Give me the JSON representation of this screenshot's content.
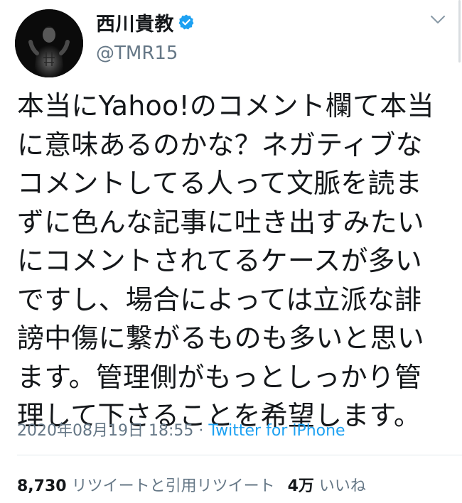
{
  "user": {
    "display_name": "西川貴教",
    "handle": "@TMR15",
    "verified": true
  },
  "tweet": {
    "lines": [
      "本当にYahoo!のコメント欄て本当",
      "に意味あるのかな？ネガティブな",
      "コメントしてる人って文脈を読ま",
      "ずに色んな記事に吐き出すみたい",
      "にコメントされてるケースが多い",
      "ですし、場合によっては立派な誹",
      "謗中傷に繋がるものも多いと思い",
      "ます。管理側がもっとしっかり管",
      "理して下さることを希望します。"
    ],
    "timestamp": "2020年08月19日 18:55",
    "separator": " · ",
    "source": "Twitter for iPhone"
  },
  "stats": {
    "retweets_count": "8,730",
    "retweets_label": "リツイートと引用リツイート",
    "likes_count": "4万",
    "likes_label": "いいね"
  },
  "icons": {
    "verified": "verified-badge-icon",
    "more": "chevron-down-icon"
  },
  "colors": {
    "text": "#14171a",
    "secondary": "#657786",
    "accent": "#1da1f2",
    "divider": "#e1e8ed"
  }
}
